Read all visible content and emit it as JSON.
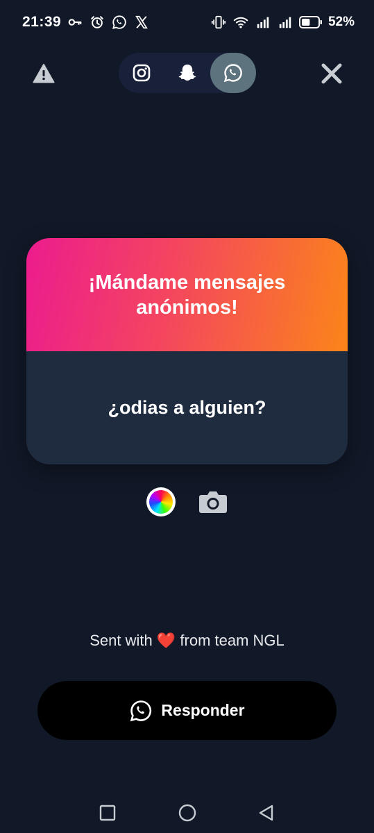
{
  "status_bar": {
    "time": "21:39",
    "battery_percent": "52%",
    "left_icons": [
      "vpn-key-icon",
      "alarm-icon",
      "whatsapp-icon",
      "x-icon"
    ],
    "right_icons": [
      "vibrate-icon",
      "wifi-icon",
      "signal-icon",
      "signal-icon",
      "battery-icon"
    ],
    "battery_level": 0.52
  },
  "toolbar": {
    "share_options": [
      {
        "name": "instagram",
        "icon": "instagram-icon",
        "active": false
      },
      {
        "name": "snapchat",
        "icon": "snapchat-icon",
        "active": false
      },
      {
        "name": "whatsapp",
        "icon": "whatsapp-icon",
        "active": true
      }
    ]
  },
  "card": {
    "title": "¡Mándame mensajes anónimos!",
    "question": "¿odias a alguien?"
  },
  "footer": {
    "sent_prefix": "Sent with",
    "heart": "❤️",
    "sent_suffix": "from team NGL",
    "reply_label": "Responder"
  },
  "colors": {
    "background": "#111827",
    "card_gradient_start": "#ec1c8e",
    "card_gradient_end": "#fb8519",
    "card_bottom": "#1f2b3f",
    "pill_background": "#19213a",
    "pill_active": "#5d737e",
    "button": "#000000"
  }
}
